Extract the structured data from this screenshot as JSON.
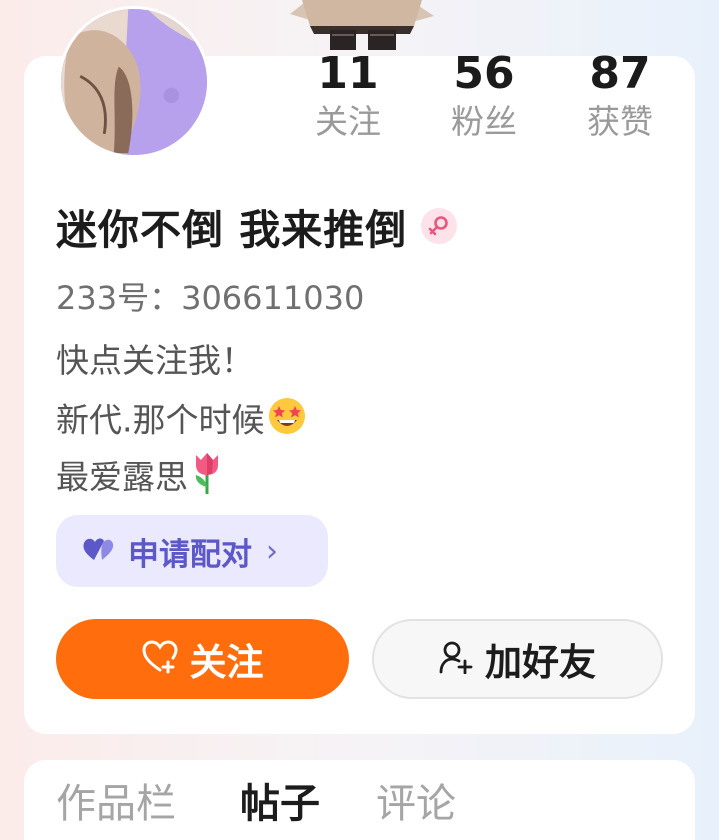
{
  "profile": {
    "name": "迷你不倒 我来推倒",
    "gender_icon": "female-symbol-icon",
    "uid_text": "233号：306611030",
    "bio": [
      "快点关注我！",
      "新代.那个时候",
      "最爱露思"
    ],
    "bio_emoji": [
      "star-struck-emoji",
      "tulip-emoji"
    ]
  },
  "stats": [
    {
      "value": "11",
      "label": "关注"
    },
    {
      "value": "56",
      "label": "粉丝"
    },
    {
      "value": "87",
      "label": "获赞"
    }
  ],
  "pair_button": {
    "label": "申请配对",
    "icon": "heart-pair-icon"
  },
  "actions": {
    "follow_label": "关注",
    "follow_icon": "heart-plus-icon",
    "add_friend_label": "加好友",
    "add_friend_icon": "person-plus-icon"
  },
  "tabs": [
    {
      "label": "作品栏",
      "active": false
    },
    {
      "label": "帖子",
      "active": true
    },
    {
      "label": "评论",
      "active": false
    }
  ],
  "colors": {
    "accent_orange": "#ff6d0d",
    "pair_bg": "#ebe9fd",
    "pair_text": "#5c58c8",
    "gender_pink": "#e8577d"
  }
}
